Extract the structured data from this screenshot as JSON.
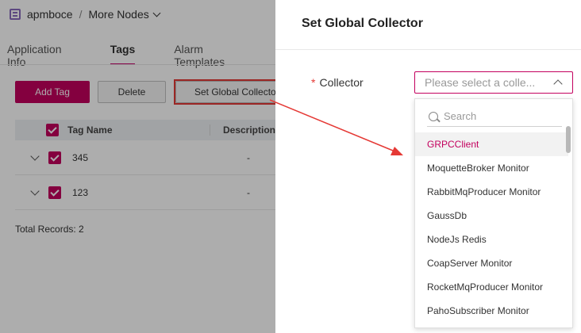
{
  "breadcrumb": {
    "app": "apmboce",
    "separator": "/",
    "current": "More Nodes"
  },
  "tabs": [
    {
      "label": "Application Info"
    },
    {
      "label": "Tags"
    },
    {
      "label": "Alarm Templates"
    }
  ],
  "toolbar": {
    "add_label": "Add Tag",
    "delete_label": "Delete",
    "set_global_label": "Set Global Collector"
  },
  "table": {
    "headers": {
      "name": "Tag Name",
      "description": "Description"
    },
    "rows": [
      {
        "name": "345",
        "description": "-"
      },
      {
        "name": "123",
        "description": "-"
      }
    ],
    "total": "Total Records: 2"
  },
  "drawer": {
    "title": "Set Global Collector",
    "field_label": "Collector",
    "required_mark": "*",
    "select_placeholder": "Please select a colle...",
    "search_placeholder": "Search",
    "options": [
      "GRPCClient",
      "MoquetteBroker Monitor",
      "RabbitMqProducer Monitor",
      "GaussDb",
      "NodeJs Redis",
      "CoapServer Monitor",
      "RocketMqProducer Monitor",
      "PahoSubscriber Monitor"
    ],
    "selected_option": "GRPCClient"
  },
  "colors": {
    "accent": "#c3005e",
    "annotation": "#e53935"
  }
}
